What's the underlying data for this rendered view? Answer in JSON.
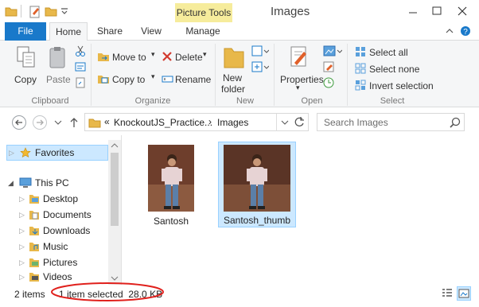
{
  "window": {
    "title": "Images",
    "context_tab": "Picture Tools"
  },
  "tabs": [
    "File",
    "Home",
    "Share",
    "View",
    "Manage"
  ],
  "ribbon": {
    "clipboard": {
      "copy": "Copy",
      "paste": "Paste",
      "group": "Clipboard"
    },
    "organize": {
      "move_to": "Move to",
      "copy_to": "Copy to",
      "delete": "Delete",
      "rename": "Rename",
      "group": "Organize"
    },
    "new": {
      "new_folder_line1": "New",
      "new_folder_line2": "folder",
      "group": "New"
    },
    "open": {
      "properties": "Properties",
      "group": "Open"
    },
    "select": {
      "select_all": "Select all",
      "select_none": "Select none",
      "invert": "Invert selection",
      "group": "Select"
    }
  },
  "address": {
    "prefix": "«",
    "crumb1": "KnockoutJS_Practice...",
    "sep": "›",
    "crumb2": "Images",
    "search_placeholder": "Search Images"
  },
  "nav": {
    "favorites": "Favorites",
    "this_pc": "This PC",
    "items": [
      "Desktop",
      "Documents",
      "Downloads",
      "Music",
      "Pictures",
      "Videos"
    ]
  },
  "files": [
    {
      "name": "Santosh",
      "selected": false
    },
    {
      "name": "Santosh_thumb",
      "selected": true
    }
  ],
  "status": {
    "count": "2 items",
    "selection": "1 item selected  28.0 KB"
  },
  "colors": {
    "file_tab": "#1979ca",
    "context_tab": "#f6ec9c",
    "selection_bg": "#cce8ff",
    "selection_border": "#99d1ff",
    "annotation": "#e0201c"
  }
}
